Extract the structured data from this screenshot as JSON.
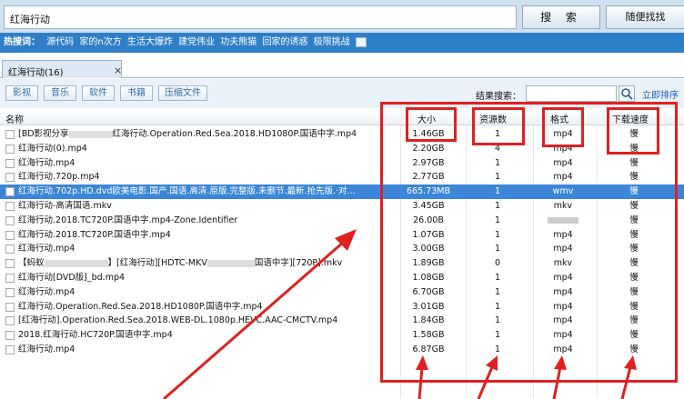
{
  "search": {
    "value": "红海行动",
    "search_button": "搜 索",
    "random_button": "随便找找"
  },
  "hot": {
    "label": "热搜词：",
    "words": [
      "源代码",
      "家的n次方",
      "生活大爆炸",
      "建党伟业",
      "功夫熊猫",
      "回家的诱惑",
      "极限挑战"
    ],
    "icon": "grid-icon"
  },
  "tab": {
    "label": "红海行动(16)",
    "close": "×"
  },
  "filters": [
    "影视",
    "音乐",
    "软件",
    "书籍",
    "压缩文件"
  ],
  "result_search": {
    "label": "结果搜索：",
    "placeholder": "",
    "icon": "magnifier-icon",
    "sort_link": "立即排序"
  },
  "columns": {
    "name": "名称",
    "size": "大小",
    "resources": "资源数",
    "format": "格式",
    "speed": "下载速度"
  },
  "rows": [
    {
      "name": "[BD影视分享",
      "name2": "红海行动.Operation.Red.Sea.2018.HD1080P.国语中字.mp4",
      "size": "1.46GB",
      "res": "1",
      "fmt": "mp4",
      "speed": "慢"
    },
    {
      "name": "红海行动(0).mp4",
      "name2": "",
      "size": "2.20GB",
      "res": "4",
      "fmt": "mp4",
      "speed": "慢"
    },
    {
      "name": "红海行动.mp4",
      "name2": "",
      "size": "2.97GB",
      "res": "1",
      "fmt": "mp4",
      "speed": "慢"
    },
    {
      "name": "红海行动.720p.mp4",
      "name2": "",
      "size": "2.77GB",
      "res": "1",
      "fmt": "mp4",
      "speed": "慢"
    },
    {
      "name": "红海行动.702p.HD.dvd欧美电影.国产.国语.高清.原版.完整版.未删节.最新.抢先版.·对...",
      "name2": "",
      "size": "665.73MB",
      "res": "1",
      "fmt": "wmv",
      "speed": "慢"
    },
    {
      "name": "红海行动-高清国语.mkv",
      "name2": "",
      "size": "3.45GB",
      "res": "1",
      "fmt": "mkv",
      "speed": "慢"
    },
    {
      "name": "红海行动.2018.TC720P.国语中字.mp4-Zone.Identifier",
      "name2": "",
      "size": "26.00B",
      "res": "1",
      "fmt": "",
      "speed": "慢"
    },
    {
      "name": "红海行动.2018.TC720P.国语中字.mp4",
      "name2": "",
      "size": "1.07GB",
      "res": "1",
      "fmt": "mp4",
      "speed": "慢"
    },
    {
      "name": "红海行动.mp4",
      "name2": "",
      "size": "3.00GB",
      "res": "1",
      "fmt": "mp4",
      "speed": "慢"
    },
    {
      "name": "【蚂蚁",
      "name2": "】[红海行动][HDTC-MKV",
      "name3": "国语中字][720P].mkv",
      "size": "1.89GB",
      "res": "0",
      "fmt": "mkv",
      "speed": "慢"
    },
    {
      "name": "红海行动[DVD版]_bd.mp4",
      "name2": "",
      "size": "1.08GB",
      "res": "1",
      "fmt": "mp4",
      "speed": "慢"
    },
    {
      "name": "红海行动.mp4",
      "name2": "",
      "size": "6.70GB",
      "res": "1",
      "fmt": "mp4",
      "speed": "慢"
    },
    {
      "name": "红海行动.Operation.Red.Sea.2018.HD1080P.国语中字.mp4",
      "name2": "",
      "size": "3.01GB",
      "res": "1",
      "fmt": "mp4",
      "speed": "慢"
    },
    {
      "name": "[红海行动].Operation.Red.Sea.2018.WEB-DL.1080p.HEVC.AAC-CMCTV.mp4",
      "name2": "",
      "size": "1.84GB",
      "res": "1",
      "fmt": "mp4",
      "speed": "慢"
    },
    {
      "name": "2018.红海行动.HC720P.国语中字.mp4",
      "name2": "",
      "size": "1.58GB",
      "res": "1",
      "fmt": "mp4",
      "speed": "慢"
    },
    {
      "name": "红海行动.mp4",
      "name2": "",
      "size": "6.87GB",
      "res": "1",
      "fmt": "mp4",
      "speed": "慢"
    }
  ],
  "selected_row": 4,
  "colors": {
    "accent": "#2f7fc8",
    "selection": "#3b86d8",
    "annotation": "#e02020"
  }
}
